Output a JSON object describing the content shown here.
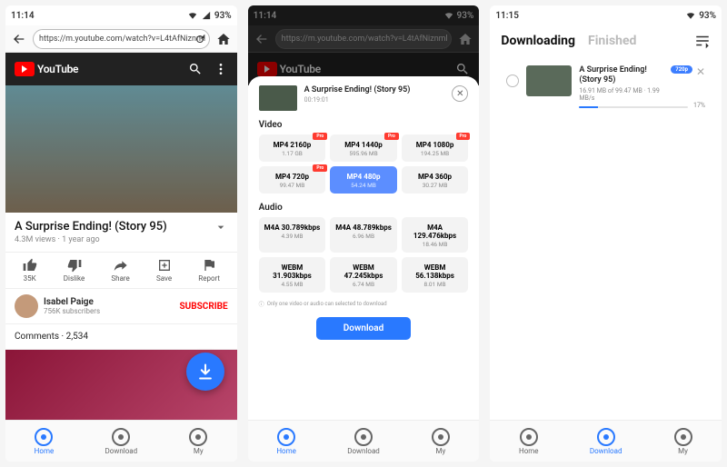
{
  "status": {
    "time1": "11:14",
    "time2": "11:15",
    "battery": "93%"
  },
  "url": "https://m.youtube.com/watch?v=L4tAfNiznml",
  "youtube": {
    "brand": "YouTube"
  },
  "video": {
    "title": "A Surprise Ending! (Story 95)",
    "views": "4.3M views",
    "age": "1 year ago",
    "duration": "00:19:01"
  },
  "actions": {
    "likes": "35K",
    "dislike": "Dislike",
    "share": "Share",
    "save": "Save",
    "report": "Report"
  },
  "channel": {
    "name": "Isabel Paige",
    "subs": "756K subscribers",
    "subscribe": "SUBSCRIBE"
  },
  "comments": {
    "label": "Comments",
    "count": "2,534"
  },
  "nav": {
    "home": "Home",
    "download": "Download",
    "my": "My"
  },
  "sheet": {
    "video_label": "Video",
    "audio_label": "Audio",
    "options_video": [
      {
        "q": "MP4 2160p",
        "sz": "1.17 GB",
        "pro": true
      },
      {
        "q": "MP4 1440p",
        "sz": "595.96 MB",
        "pro": true
      },
      {
        "q": "MP4 1080p",
        "sz": "194.25 MB",
        "pro": true
      },
      {
        "q": "MP4 720p",
        "sz": "99.47 MB",
        "pro": true
      },
      {
        "q": "MP4 480p",
        "sz": "54.24 MB",
        "sel": true
      },
      {
        "q": "MP4 360p",
        "sz": "30.27 MB"
      }
    ],
    "options_audio": [
      {
        "q": "M4A 30.789kbps",
        "sz": "4.39 MB"
      },
      {
        "q": "M4A 48.789kbps",
        "sz": "6.96 MB"
      },
      {
        "q": "M4A 129.476kbps",
        "sz": "18.46 MB"
      },
      {
        "q": "WEBM 31.903kbps",
        "sz": "4.55 MB"
      },
      {
        "q": "WEBM 47.245kbps",
        "sz": "6.74 MB"
      },
      {
        "q": "WEBM 56.138kbps",
        "sz": "8.01 MB"
      }
    ],
    "note": "Only one video or audio can selected to download",
    "download": "Download"
  },
  "downloads": {
    "tab_downloading": "Downloading",
    "tab_finished": "Finished",
    "item": {
      "title": "A Surprise Ending! (Story 95)",
      "progress": "16.91 MB of 99.47 MB · 1.99 MB/s",
      "quality": "720p",
      "percent": "17%"
    }
  }
}
